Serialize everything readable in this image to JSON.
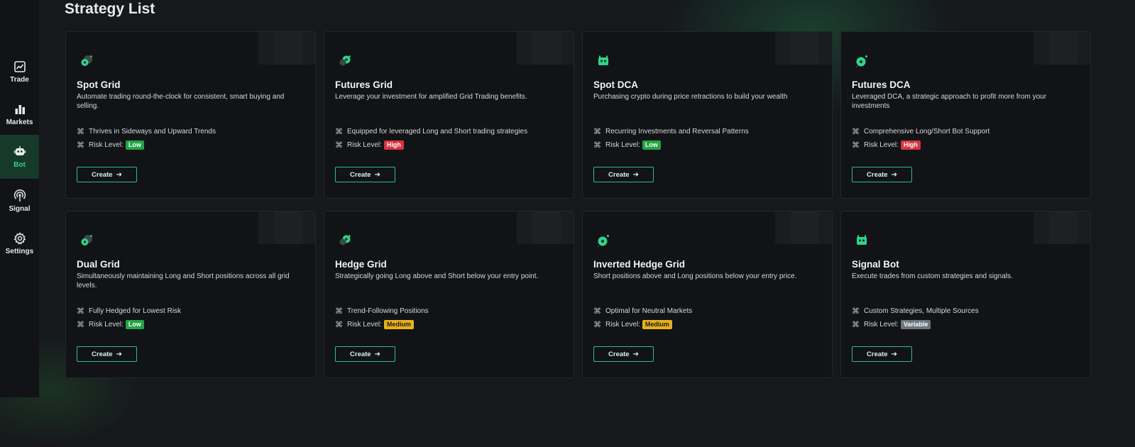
{
  "page": {
    "title": "Strategy List"
  },
  "nav": [
    {
      "id": "trade",
      "label": "Trade",
      "icon": "chart-line-icon",
      "active": false
    },
    {
      "id": "markets",
      "label": "Markets",
      "icon": "bar-chart-icon",
      "active": false
    },
    {
      "id": "bot",
      "label": "Bot",
      "icon": "robot-icon",
      "active": true
    },
    {
      "id": "signal",
      "label": "Signal",
      "icon": "broadcast-icon",
      "active": false
    },
    {
      "id": "settings",
      "label": "Settings",
      "icon": "gear-icon",
      "active": false
    }
  ],
  "colors": {
    "accent": "#2fd489",
    "low": "#22a544",
    "high": "#d9333f",
    "medium": "#e7b118",
    "variable": "#6c757d"
  },
  "risk_label": "Risk Level:",
  "create_label": "Create",
  "strategies": [
    {
      "name": "Spot Grid",
      "icon": "grid-bot-icon",
      "description": "Automate trading round-the-clock for consistent, smart buying and selling.",
      "feature": "Thrives in Sideways and Upward Trends",
      "risk": "Low",
      "risk_type": "low"
    },
    {
      "name": "Futures Grid",
      "icon": "futures-grid-icon",
      "description": "Leverage your investment for amplified Grid Trading benefits.",
      "feature": "Equipped for leveraged Long and Short trading strategies",
      "risk": "High",
      "risk_type": "high"
    },
    {
      "name": "Spot DCA",
      "icon": "dca-bot-icon",
      "description": "Purchasing crypto during price retractions to build your wealth",
      "feature": "Recurring Investments and Reversal Patterns",
      "risk": "Low",
      "risk_type": "low"
    },
    {
      "name": "Futures DCA",
      "icon": "futures-dca-icon",
      "description": "Leveraged DCA, a strategic approach to profit more from your investments",
      "feature": "Comprehensive Long/Short Bot Support",
      "risk": "High",
      "risk_type": "high"
    },
    {
      "name": "Dual Grid",
      "icon": "grid-bot-icon",
      "description": "Simultaneously maintaining Long and Short positions across all grid levels.",
      "feature": "Fully Hedged for Lowest Risk",
      "risk": "Low",
      "risk_type": "low"
    },
    {
      "name": "Hedge Grid",
      "icon": "futures-grid-icon",
      "description": "Strategically going Long above and Short below your entry point.",
      "feature": "Trend-Following Positions",
      "risk": "Medium",
      "risk_type": "medium"
    },
    {
      "name": "Inverted Hedge Grid",
      "icon": "futures-dca-icon",
      "description": "Short positions above and Long positions below your entry price.",
      "feature": "Optimal for Neutral Markets",
      "risk": "Medium",
      "risk_type": "medium"
    },
    {
      "name": "Signal Bot",
      "icon": "dca-bot-icon",
      "description": "Execute trades from custom strategies and signals.",
      "feature": "Custom Strategies, Multiple Sources",
      "risk": "Variable",
      "risk_type": "variable"
    }
  ]
}
